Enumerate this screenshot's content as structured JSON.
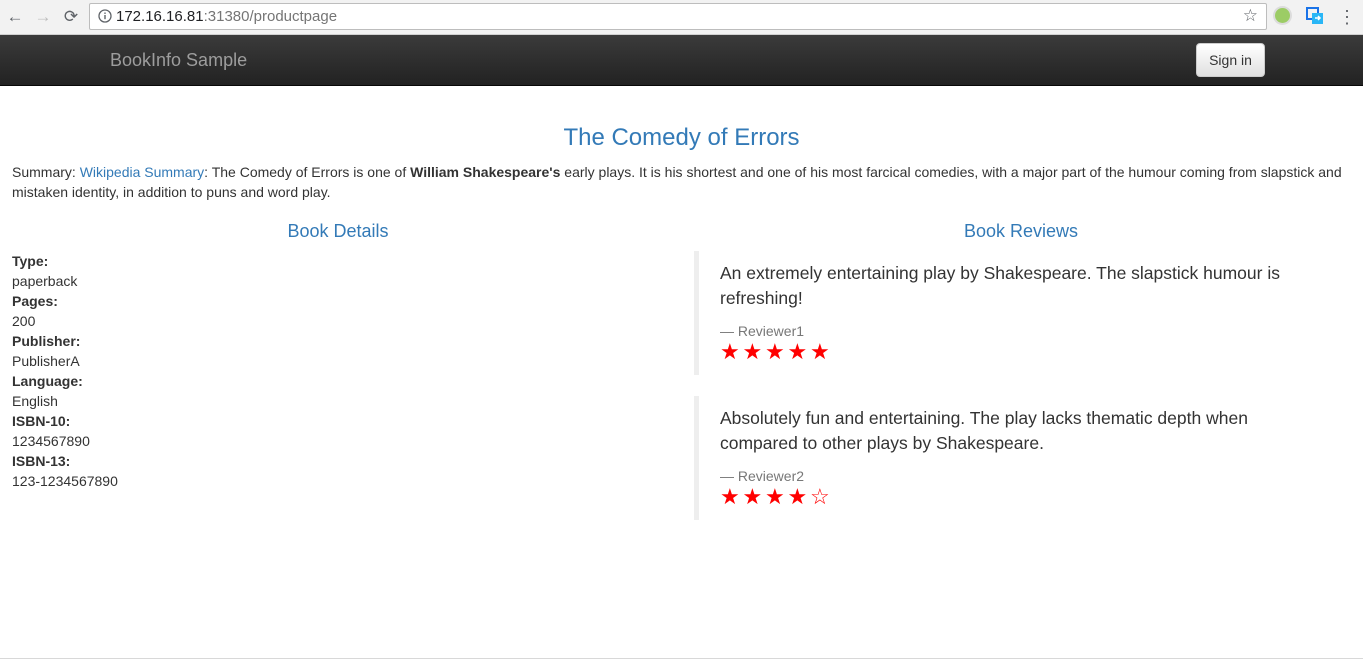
{
  "browser": {
    "back_icon": "←",
    "forward_icon": "→",
    "reload_icon": "⟳",
    "url_host": "172.16.16.81",
    "url_path": ":31380/productpage",
    "bookmark_icon": "☆",
    "menu_icon": "⋮"
  },
  "navbar": {
    "brand": "BookInfo Sample",
    "signin_label": "Sign in"
  },
  "book": {
    "title": "The Comedy of Errors",
    "summary_label": "Summary:",
    "summary_link": "Wikipedia Summary",
    "summary_text_1": ": The Comedy of Errors is one of ",
    "summary_author": "William Shakespeare's",
    "summary_text_2": " early plays. It is his shortest and one of his most farcical comedies, with a major part of the humour coming from slapstick and mistaken identity, in addition to puns and word play."
  },
  "details": {
    "heading": "Book Details",
    "items": [
      {
        "label": "Type:",
        "value": "paperback"
      },
      {
        "label": "Pages:",
        "value": "200"
      },
      {
        "label": "Publisher:",
        "value": "PublisherA"
      },
      {
        "label": "Language:",
        "value": "English"
      },
      {
        "label": "ISBN-10:",
        "value": "1234567890"
      },
      {
        "label": "ISBN-13:",
        "value": "123-1234567890"
      }
    ]
  },
  "reviews": {
    "heading": "Book Reviews",
    "items": [
      {
        "text": "An extremely entertaining play by Shakespeare. The slapstick humour is refreshing!",
        "reviewer": "— Reviewer1",
        "rating": 5,
        "max": 5
      },
      {
        "text": "Absolutely fun and entertaining. The play lacks thematic depth when compared to other plays by Shakespeare.",
        "reviewer": "— Reviewer2",
        "rating": 4,
        "max": 5
      }
    ],
    "star_color": "#ff0000"
  },
  "colors": {
    "link": "#337ab7",
    "navbar_bg": "#222222"
  }
}
